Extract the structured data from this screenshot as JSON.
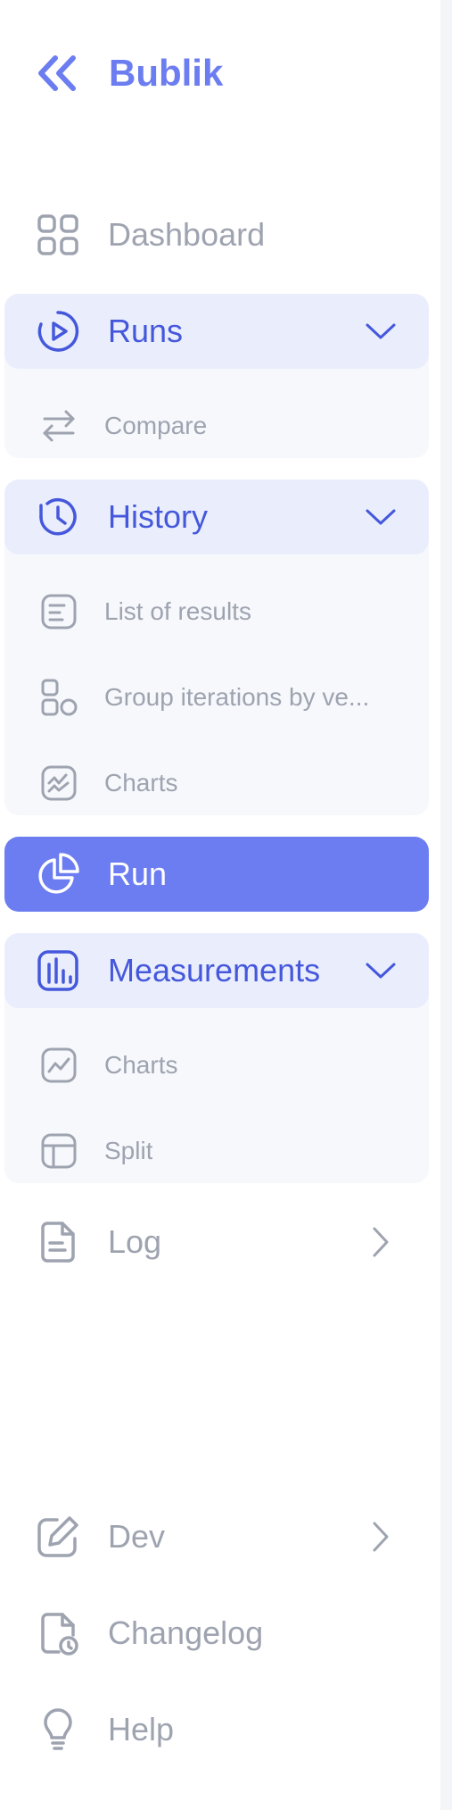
{
  "brand": {
    "name": "Bublik",
    "color": "#6b7df0",
    "collapse_icon": "double-chevron-left-icon"
  },
  "nav": {
    "dashboard": {
      "label": "Dashboard",
      "icon": "grid-icon"
    },
    "runs": {
      "label": "Runs",
      "icon": "play-circle-icon",
      "expanded": true,
      "children": [
        {
          "label": "Compare",
          "icon": "arrows-swap-icon"
        }
      ]
    },
    "history": {
      "label": "History",
      "icon": "clock-icon",
      "expanded": true,
      "children": [
        {
          "label": "List of results",
          "icon": "document-lines-icon"
        },
        {
          "label": "Group iterations by ve...",
          "icon": "grouped-shapes-icon"
        },
        {
          "label": "Charts",
          "icon": "chart-zigzag-icon"
        }
      ]
    },
    "run": {
      "label": "Run",
      "icon": "pie-chart-icon",
      "active": true
    },
    "measurements": {
      "label": "Measurements",
      "icon": "bar-chart-icon",
      "expanded": true,
      "children": [
        {
          "label": "Charts",
          "icon": "line-chart-icon"
        },
        {
          "label": "Split",
          "icon": "layout-split-icon"
        }
      ]
    },
    "log": {
      "label": "Log",
      "icon": "file-text-icon"
    },
    "dev": {
      "label": "Dev",
      "icon": "edit-icon"
    },
    "changelog": {
      "label": "Changelog",
      "icon": "file-clock-icon"
    },
    "help": {
      "label": "Help",
      "icon": "lightbulb-icon"
    }
  },
  "colors": {
    "accent": "#6b7df0",
    "accent_text": "#4558dc",
    "open_bg": "#eaeefc",
    "group_bg": "#f7f8fc",
    "muted_text": "#9ea3b0"
  }
}
